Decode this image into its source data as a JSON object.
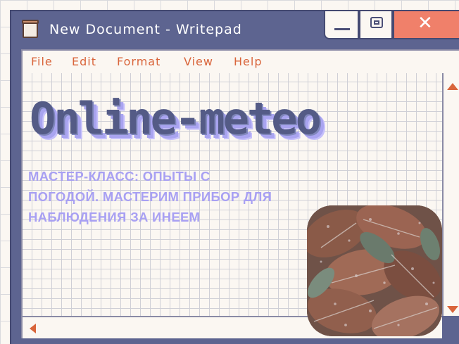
{
  "window": {
    "title": "New Document - Writepad",
    "controls": {
      "minimize_icon": "minimize-icon",
      "maximize_icon": "maximize-icon",
      "close_icon": "close-icon",
      "close_glyph": "✕"
    }
  },
  "menu": {
    "items": [
      "File",
      "Edit",
      "Format",
      "View",
      "Help"
    ]
  },
  "document": {
    "headline": "Online-meteo",
    "subtitle_lines": [
      "МАСТЕР-КЛАСС: ОПЫТЫ С",
      "ПОГОДОЙ. МАСТЕРИМ ПРИБОР ДЛЯ",
      "НАБЛЮДЕНИЯ ЗА ИНЕЕМ"
    ]
  },
  "colors": {
    "window_frame": "#5d6490",
    "menu_text": "#d9653b",
    "close_button": "#f0806a",
    "headline": "#545b86",
    "subtitle": "#a8a0f3",
    "paper": "#fbf7f2"
  }
}
